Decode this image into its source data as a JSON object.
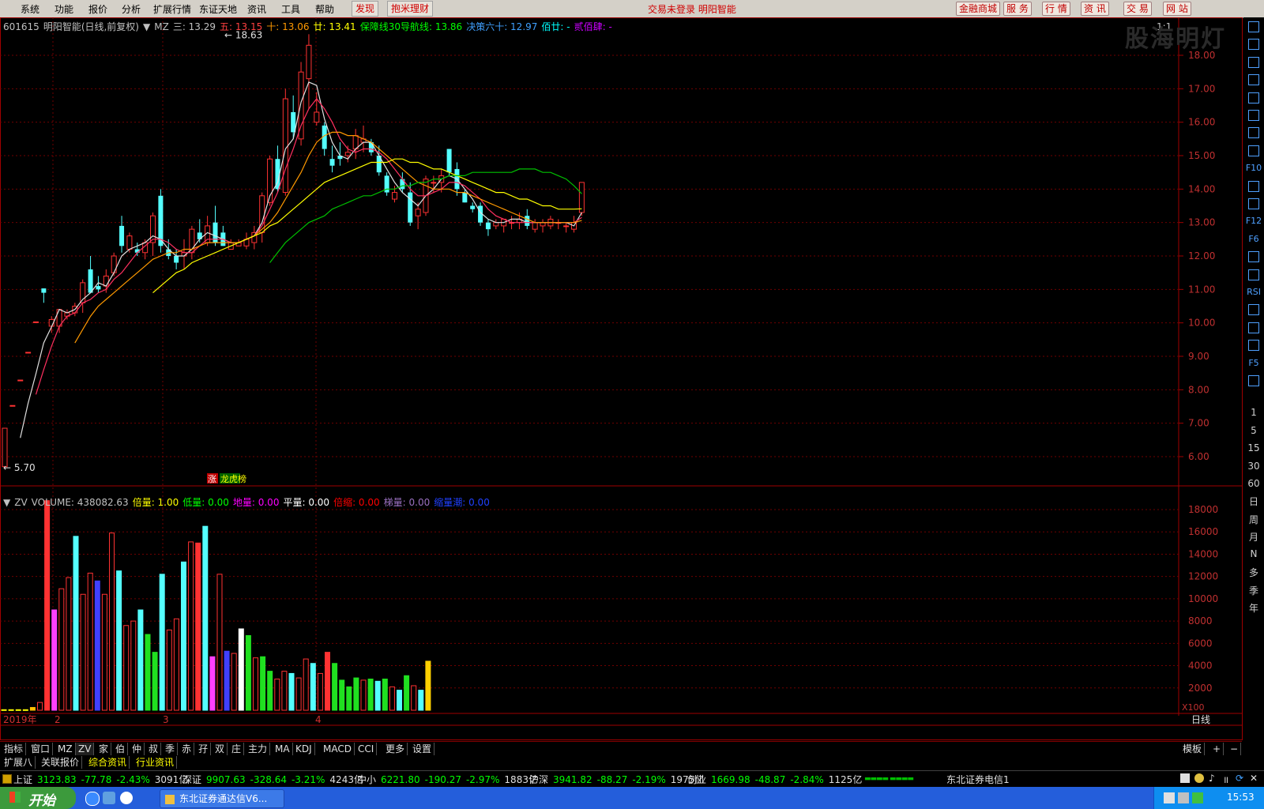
{
  "menu": {
    "items": [
      "系统",
      "功能",
      "报价",
      "分析",
      "扩展行情",
      "东证天地",
      "资讯",
      "工具",
      "帮助"
    ],
    "btn_faxian": "发现",
    "btn_licai": "抱米理财",
    "status_text": "交易未登录  明阳智能",
    "right_buttons": [
      "金融商城",
      "服 务",
      "行 情",
      "资 讯",
      "交 易",
      "网 站"
    ]
  },
  "watermark": "股海明灯",
  "price_panel": {
    "code": "601615",
    "name": "明阳智能(日线,前复权)",
    "indicator": "MZ",
    "items": [
      {
        "label": "三:",
        "value": "13.29",
        "color": "#c0c0c0"
      },
      {
        "label": "五:",
        "value": "13.15",
        "color": "#ff4040"
      },
      {
        "label": "十:",
        "value": "13.06",
        "color": "#ff9900"
      },
      {
        "label": "廿:",
        "value": "13.41",
        "color": "#ffff00"
      },
      {
        "label": "保障线30导航线:",
        "value": "13.86",
        "color": "#00ff00"
      },
      {
        "label": "决策六十:",
        "value": "12.97",
        "color": "#3fa0ff"
      },
      {
        "label": "佰廿:",
        "value": "-",
        "color": "#00ffff"
      },
      {
        "label": "贰佰肆:",
        "value": "-",
        "color": "#cc00ff"
      }
    ],
    "high_label": "18.63",
    "low_label": "5.70",
    "corner_label": "1:1",
    "badge_zhang": "涨",
    "badge_longhu": "龙虎榜",
    "y_ticks": [
      "18.00",
      "17.00",
      "16.00",
      "15.00",
      "14.00",
      "13.00",
      "12.00",
      "11.00",
      "10.00",
      "9.00",
      "8.00",
      "7.00",
      "6.00"
    ]
  },
  "volume_panel": {
    "indicator": "ZV",
    "items": [
      {
        "label": "VOLUME:",
        "value": "438082.63",
        "color": "#c0c0c0"
      },
      {
        "label": "倍量:",
        "value": "1.00",
        "color": "#ffff00"
      },
      {
        "label": "低量:",
        "value": "0.00",
        "color": "#00ff00"
      },
      {
        "label": "地量:",
        "value": "0.00",
        "color": "#ff00ff"
      },
      {
        "label": "平量:",
        "value": "0.00",
        "color": "#ffffff"
      },
      {
        "label": "倍缩:",
        "value": "0.00",
        "color": "#ff0000"
      },
      {
        "label": "梯量:",
        "value": "0.00",
        "color": "#9a70c0"
      },
      {
        "label": "缩量潮:",
        "value": "0.00",
        "color": "#2040ff"
      }
    ],
    "y_ticks": [
      "18000",
      "16000",
      "14000",
      "12000",
      "10000",
      "8000",
      "6000",
      "4000",
      "2000"
    ],
    "unit": "X100"
  },
  "date_axis": {
    "labels": [
      "2019年",
      "2",
      "3",
      "4"
    ],
    "period": "日线"
  },
  "tabs": [
    "指标",
    "窗口",
    "MZ",
    "ZV",
    "家",
    "伯",
    "仲",
    "叔",
    "季",
    "赤",
    "孖",
    "双",
    "庄",
    "主力",
    "MA",
    "KDJ",
    "MACD",
    "CCI",
    "更多",
    "设置"
  ],
  "tabs_right": [
    "模板",
    "+",
    "−"
  ],
  "tabs2": [
    {
      "label": "扩展八",
      "color": "#e0e0e0"
    },
    {
      "label": "关联报价",
      "color": "#e0e0e0"
    },
    {
      "label": "综合资讯",
      "color": "#ffff00"
    },
    {
      "label": "行业资讯",
      "color": "#ffff00"
    }
  ],
  "right_toolbar": {
    "icons": [
      "arrow-left-icon",
      "arrow-up-icon",
      "arrow-down-icon",
      "chart-icon",
      "grid-icon",
      "line-icon",
      "candle-icon",
      "list-icon",
      "f10-icon",
      "info-icon",
      "f-icon",
      "f12-icon",
      "f6-icon",
      "circle-icon",
      "wave-icon",
      "rsi-icon",
      "dollar-icon",
      "move-icon",
      "pen-icon",
      "f5-icon",
      "image-icon"
    ],
    "icon_labels": {
      "f10-icon": "F10",
      "f12-icon": "F12",
      "f6-icon": "F6",
      "rsi-icon": "RSI",
      "f5-icon": "F5"
    },
    "minute_periods": [
      "1",
      "5",
      "15",
      "30",
      "60"
    ],
    "periods": [
      "日",
      "周",
      "月",
      "N",
      "多",
      "季",
      "年"
    ]
  },
  "indices": [
    {
      "name": "上证",
      "value": "3123.83",
      "change": "-77.78",
      "pct": "-2.43%",
      "amount": "3091亿"
    },
    {
      "name": "深证",
      "value": "9907.63",
      "change": "-328.64",
      "pct": "-3.21%",
      "amount": "4243亿"
    },
    {
      "name": "中小",
      "value": "6221.80",
      "change": "-190.27",
      "pct": "-2.97%",
      "amount": "1883亿"
    },
    {
      "name": "沪深",
      "value": "3941.82",
      "change": "-88.27",
      "pct": "-2.19%",
      "amount": "1975亿"
    },
    {
      "name": "创业",
      "value": "1669.98",
      "change": "-48.87",
      "pct": "-2.84%",
      "amount": "1125亿"
    }
  ],
  "broker": "东北证券电信1",
  "taskbar": {
    "start": "开始",
    "app": "东北证券通达信V6...",
    "clock": "15:53"
  },
  "chart_data": {
    "type": "candlestick",
    "candles": [
      {
        "o": 5.7,
        "h": 6.85,
        "l": 5.7,
        "c": 6.85
      },
      {
        "o": 7.53,
        "h": 7.53,
        "l": 7.53,
        "c": 7.53
      },
      {
        "o": 8.29,
        "h": 8.29,
        "l": 8.29,
        "c": 8.29
      },
      {
        "o": 9.12,
        "h": 9.12,
        "l": 9.12,
        "c": 9.12
      },
      {
        "o": 10.03,
        "h": 10.03,
        "l": 10.03,
        "c": 10.03
      },
      {
        "o": 11.03,
        "h": 11.03,
        "l": 10.6,
        "c": 10.9
      },
      {
        "o": 9.9,
        "h": 10.2,
        "l": 9.7,
        "c": 10.1
      },
      {
        "o": 9.9,
        "h": 10.4,
        "l": 9.7,
        "c": 10.4
      },
      {
        "o": 10.2,
        "h": 10.4,
        "l": 10.1,
        "c": 10.3
      },
      {
        "o": 10.3,
        "h": 10.6,
        "l": 10.2,
        "c": 10.5
      },
      {
        "o": 10.6,
        "h": 11.3,
        "l": 10.3,
        "c": 11.2
      },
      {
        "o": 11.6,
        "h": 12.0,
        "l": 10.9,
        "c": 10.9
      },
      {
        "o": 11.1,
        "h": 11.4,
        "l": 10.9,
        "c": 11.0
      },
      {
        "o": 11.1,
        "h": 11.6,
        "l": 10.9,
        "c": 11.4
      },
      {
        "o": 11.5,
        "h": 12.1,
        "l": 11.4,
        "c": 12.0
      },
      {
        "o": 12.9,
        "h": 13.2,
        "l": 12.1,
        "c": 12.3
      },
      {
        "o": 12.2,
        "h": 12.7,
        "l": 12.1,
        "c": 12.6
      },
      {
        "o": 12.2,
        "h": 12.4,
        "l": 12.0,
        "c": 12.1
      },
      {
        "o": 12.1,
        "h": 12.5,
        "l": 11.9,
        "c": 12.4
      },
      {
        "o": 12.4,
        "h": 13.3,
        "l": 12.0,
        "c": 13.2
      },
      {
        "o": 13.8,
        "h": 14.0,
        "l": 12.1,
        "c": 12.3
      },
      {
        "o": 12.2,
        "h": 12.5,
        "l": 11.9,
        "c": 12.0
      },
      {
        "o": 12.0,
        "h": 12.2,
        "l": 11.6,
        "c": 11.8
      },
      {
        "o": 12.0,
        "h": 12.5,
        "l": 11.6,
        "c": 12.1
      },
      {
        "o": 12.1,
        "h": 12.9,
        "l": 11.9,
        "c": 12.8
      },
      {
        "o": 12.7,
        "h": 13.1,
        "l": 12.4,
        "c": 12.5
      },
      {
        "o": 12.4,
        "h": 13.2,
        "l": 12.3,
        "c": 12.9
      },
      {
        "o": 13.0,
        "h": 13.5,
        "l": 12.3,
        "c": 12.4
      },
      {
        "o": 12.7,
        "h": 12.9,
        "l": 12.3,
        "c": 12.3
      },
      {
        "o": 12.2,
        "h": 12.5,
        "l": 12.2,
        "c": 12.4
      },
      {
        "o": 12.3,
        "h": 12.5,
        "l": 12.3,
        "c": 12.4
      },
      {
        "o": 12.3,
        "h": 12.7,
        "l": 12.2,
        "c": 12.5
      },
      {
        "o": 12.4,
        "h": 12.9,
        "l": 12.2,
        "c": 12.7
      },
      {
        "o": 12.7,
        "h": 13.9,
        "l": 12.4,
        "c": 13.8
      },
      {
        "o": 13.6,
        "h": 15.0,
        "l": 13.5,
        "c": 14.9
      },
      {
        "o": 14.9,
        "h": 15.3,
        "l": 13.9,
        "c": 14.0
      },
      {
        "o": 13.9,
        "h": 17.0,
        "l": 13.8,
        "c": 16.7
      },
      {
        "o": 16.3,
        "h": 16.8,
        "l": 15.5,
        "c": 15.7
      },
      {
        "o": 15.5,
        "h": 17.8,
        "l": 15.3,
        "c": 17.5
      },
      {
        "o": 17.3,
        "h": 18.63,
        "l": 16.4,
        "c": 18.3
      },
      {
        "o": 16.0,
        "h": 16.9,
        "l": 15.9,
        "c": 16.3
      },
      {
        "o": 15.9,
        "h": 16.0,
        "l": 15.0,
        "c": 15.2
      },
      {
        "o": 14.9,
        "h": 15.3,
        "l": 14.5,
        "c": 14.7
      },
      {
        "o": 15.0,
        "h": 15.4,
        "l": 14.7,
        "c": 14.9
      },
      {
        "o": 15.0,
        "h": 15.3,
        "l": 14.8,
        "c": 15.1
      },
      {
        "o": 15.2,
        "h": 15.8,
        "l": 14.9,
        "c": 15.6
      },
      {
        "o": 15.4,
        "h": 15.9,
        "l": 15.1,
        "c": 15.5
      },
      {
        "o": 15.4,
        "h": 15.5,
        "l": 15.0,
        "c": 15.1
      },
      {
        "o": 15.0,
        "h": 15.3,
        "l": 14.4,
        "c": 14.5
      },
      {
        "o": 14.4,
        "h": 14.5,
        "l": 13.8,
        "c": 13.9
      },
      {
        "o": 13.7,
        "h": 14.1,
        "l": 13.6,
        "c": 13.9
      },
      {
        "o": 14.3,
        "h": 14.5,
        "l": 13.9,
        "c": 14.0
      },
      {
        "o": 13.9,
        "h": 14.2,
        "l": 12.9,
        "c": 13.0
      },
      {
        "o": 13.2,
        "h": 13.6,
        "l": 12.8,
        "c": 13.4
      },
      {
        "o": 13.3,
        "h": 14.4,
        "l": 13.2,
        "c": 14.3
      },
      {
        "o": 14.2,
        "h": 14.4,
        "l": 13.9,
        "c": 14.2
      },
      {
        "o": 14.2,
        "h": 14.6,
        "l": 13.9,
        "c": 14.4
      },
      {
        "o": 15.2,
        "h": 15.2,
        "l": 14.4,
        "c": 14.5
      },
      {
        "o": 14.6,
        "h": 14.8,
        "l": 13.8,
        "c": 14.0
      },
      {
        "o": 13.9,
        "h": 14.0,
        "l": 13.6,
        "c": 13.6
      },
      {
        "o": 13.5,
        "h": 13.6,
        "l": 13.3,
        "c": 13.4
      },
      {
        "o": 13.5,
        "h": 13.6,
        "l": 12.9,
        "c": 13.0
      },
      {
        "o": 13.0,
        "h": 13.1,
        "l": 12.6,
        "c": 12.8
      },
      {
        "o": 12.9,
        "h": 13.1,
        "l": 12.8,
        "c": 13.0
      },
      {
        "o": 12.9,
        "h": 13.1,
        "l": 12.7,
        "c": 13.1
      },
      {
        "o": 13.0,
        "h": 13.2,
        "l": 12.8,
        "c": 13.0
      },
      {
        "o": 13.0,
        "h": 13.3,
        "l": 12.8,
        "c": 13.1
      },
      {
        "o": 13.2,
        "h": 13.4,
        "l": 12.8,
        "c": 12.9
      },
      {
        "o": 12.8,
        "h": 13.1,
        "l": 12.7,
        "c": 13.0
      },
      {
        "o": 12.9,
        "h": 13.1,
        "l": 12.7,
        "c": 13.0
      },
      {
        "o": 12.9,
        "h": 13.2,
        "l": 12.8,
        "c": 13.1
      },
      {
        "o": 13.0,
        "h": 13.1,
        "l": 12.8,
        "c": 13.0
      },
      {
        "o": 12.9,
        "h": 13.0,
        "l": 12.7,
        "c": 12.9
      },
      {
        "o": 12.8,
        "h": 13.2,
        "l": 12.7,
        "c": 13.0
      },
      {
        "o": 13.3,
        "h": 14.2,
        "l": 13.2,
        "c": 14.2
      }
    ],
    "volume": [
      50,
      50,
      50,
      50,
      250,
      700,
      18800,
      9000,
      10900,
      11900,
      15600,
      10400,
      12300,
      11600,
      10400,
      15900,
      12500,
      7600,
      8000,
      9000,
      6800,
      5200,
      12200,
      7200,
      8200,
      13300,
      15100,
      15000,
      16500,
      4800,
      12200,
      5300,
      5100,
      7300,
      6700,
      4700,
      4800,
      3500,
      2800,
      3500,
      3300,
      2900,
      4600,
      4200,
      3300,
      5200,
      4200,
      2700,
      2100,
      2900,
      2700,
      2800,
      2600,
      2800,
      2100,
      1800,
      3100,
      2200,
      1800,
      4400
    ],
    "ma_series": [
      {
        "name": "三",
        "color": "#e0e0e0",
        "values": [
          null,
          null,
          6.56,
          7.6,
          8.48,
          9.4,
          9.88,
          10.4,
          10.3,
          10.4,
          10.7,
          10.9,
          11.2,
          11.1,
          11.5,
          12.0,
          12.2,
          12.3,
          12.4,
          12.6,
          12.5,
          12.2,
          12.0,
          12.0,
          12.2,
          12.5,
          12.7,
          12.6,
          12.5,
          12.4,
          12.4,
          12.5,
          12.6,
          13.0,
          13.8,
          14.2,
          15.2,
          15.5,
          16.6,
          17.2,
          17.1,
          16.1,
          15.4,
          15.0,
          14.9,
          15.2,
          15.4,
          15.4,
          15.0,
          14.6,
          14.2,
          13.9,
          13.7,
          13.5,
          13.8,
          14.0,
          14.3,
          14.4,
          14.3,
          14.0,
          13.7,
          13.3,
          13.1,
          13.0,
          13.0,
          13.1,
          13.1,
          13.0,
          13.0,
          13.0,
          13.0,
          13.0,
          13.0,
          12.9,
          13.3
        ]
      },
      {
        "name": "五",
        "color": "#ff3060",
        "values": [
          null,
          null,
          null,
          null,
          7.86,
          8.6,
          9.3,
          9.9,
          10.2,
          10.3,
          10.6,
          10.7,
          10.9,
          11.0,
          11.3,
          11.5,
          11.8,
          12.1,
          12.3,
          12.5,
          12.5,
          12.4,
          12.2,
          12.1,
          12.1,
          12.3,
          12.5,
          12.5,
          12.5,
          12.4,
          12.4,
          12.5,
          12.6,
          12.9,
          13.4,
          13.9,
          14.6,
          15.2,
          15.9,
          16.4,
          16.7,
          16.4,
          16.0,
          15.5,
          15.2,
          15.1,
          15.2,
          15.2,
          15.1,
          14.9,
          14.6,
          14.3,
          14.0,
          13.8,
          13.8,
          13.9,
          14.0,
          14.2,
          14.2,
          14.1,
          13.9,
          13.7,
          13.4,
          13.2,
          13.1,
          13.0,
          13.0,
          13.0,
          13.0,
          13.0,
          13.0,
          13.0,
          13.0,
          13.0,
          13.15
        ]
      },
      {
        "name": "十",
        "color": "#ff9900",
        "values": [
          null,
          null,
          null,
          null,
          null,
          null,
          null,
          null,
          null,
          9.4,
          9.8,
          10.2,
          10.5,
          10.7,
          10.9,
          11.1,
          11.3,
          11.5,
          11.7,
          11.9,
          12.0,
          12.1,
          12.1,
          12.2,
          12.2,
          12.3,
          12.4,
          12.4,
          12.4,
          12.4,
          12.4,
          12.5,
          12.6,
          12.8,
          13.0,
          13.3,
          13.7,
          14.1,
          14.5,
          15.0,
          15.4,
          15.6,
          15.7,
          15.7,
          15.6,
          15.6,
          15.5,
          15.4,
          15.2,
          15.0,
          14.8,
          14.6,
          14.4,
          14.2,
          14.1,
          14.0,
          14.0,
          14.0,
          13.9,
          13.9,
          13.8,
          13.7,
          13.6,
          13.5,
          13.4,
          13.3,
          13.2,
          13.1,
          13.0,
          13.0,
          13.0,
          13.0,
          13.0,
          13.0,
          13.06
        ]
      },
      {
        "name": "廿",
        "color": "#ffff00",
        "values": [
          null,
          null,
          null,
          null,
          null,
          null,
          null,
          null,
          null,
          null,
          null,
          null,
          null,
          null,
          null,
          null,
          null,
          null,
          null,
          10.9,
          11.1,
          11.3,
          11.5,
          11.6,
          11.8,
          11.9,
          12.0,
          12.1,
          12.2,
          12.3,
          12.4,
          12.5,
          12.6,
          12.7,
          12.9,
          13.0,
          13.2,
          13.4,
          13.6,
          13.8,
          14.0,
          14.2,
          14.3,
          14.4,
          14.5,
          14.6,
          14.7,
          14.8,
          14.8,
          14.8,
          14.9,
          14.9,
          14.8,
          14.8,
          14.7,
          14.6,
          14.6,
          14.5,
          14.4,
          14.3,
          14.2,
          14.1,
          14.0,
          13.9,
          13.9,
          13.8,
          13.7,
          13.7,
          13.6,
          13.5,
          13.5,
          13.4,
          13.4,
          13.4,
          13.41
        ]
      },
      {
        "name": "保障线30导航线",
        "color": "#00c000",
        "values": [
          null,
          null,
          null,
          null,
          null,
          null,
          null,
          null,
          null,
          null,
          null,
          null,
          null,
          null,
          null,
          null,
          null,
          null,
          null,
          null,
          null,
          null,
          null,
          null,
          null,
          null,
          null,
          null,
          null,
          null,
          null,
          null,
          null,
          null,
          11.8,
          12.1,
          12.4,
          12.6,
          12.8,
          13.0,
          13.1,
          13.2,
          13.4,
          13.5,
          13.6,
          13.7,
          13.8,
          13.8,
          13.9,
          14.0,
          14.0,
          14.1,
          14.1,
          14.2,
          14.2,
          14.3,
          14.3,
          14.4,
          14.4,
          14.4,
          14.5,
          14.5,
          14.5,
          14.5,
          14.5,
          14.5,
          14.6,
          14.6,
          14.6,
          14.5,
          14.5,
          14.4,
          14.3,
          14.1,
          13.86
        ]
      }
    ]
  }
}
